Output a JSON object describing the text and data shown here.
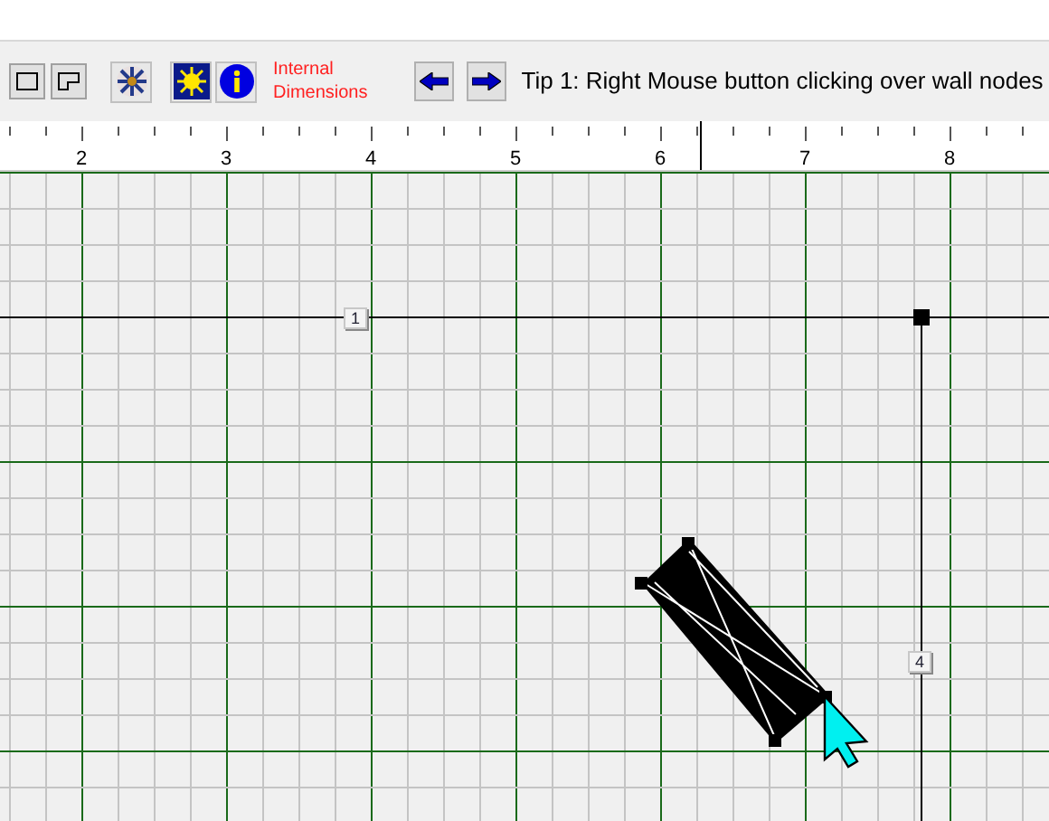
{
  "toolbar": {
    "buttons": [
      {
        "kind": "rectangle"
      },
      {
        "kind": "l-shape"
      },
      {
        "kind": "snowflake"
      },
      {
        "kind": "sun"
      },
      {
        "kind": "info"
      }
    ],
    "mode_label": [
      "Internal",
      "Dimensions"
    ],
    "nav_buttons": [
      {
        "kind": "left"
      },
      {
        "kind": "right"
      }
    ],
    "tip": "Tip 1: Right Mouse button clicking over wall nodes"
  },
  "ruler": {
    "labels": [
      "2",
      "3",
      "4",
      "5",
      "6",
      "7",
      "8"
    ]
  },
  "canvas": {
    "node_labels": [
      {
        "text": "1",
        "kind": "horizontal"
      },
      {
        "text": "4",
        "kind": "vertical"
      }
    ]
  }
}
